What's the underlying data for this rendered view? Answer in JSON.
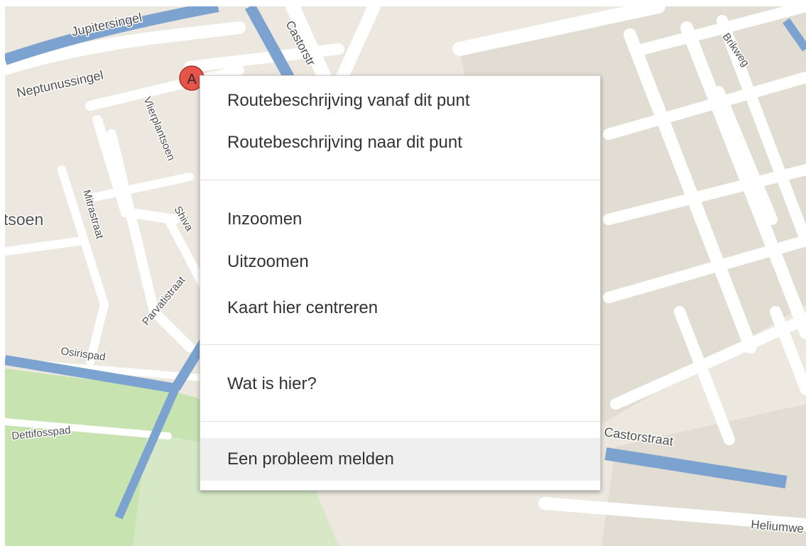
{
  "map": {
    "street_labels": {
      "jupitersingel": "Jupitersingel",
      "neptunussingel": "Neptunussingel",
      "castorstraat_top": "Castorstr",
      "brikweg": "Brikweg",
      "vlierplantsoen": "Vlierplantsoen",
      "plantsoen": "tsoen",
      "mitrastraat": "Mitrastraat",
      "shiva": "Shiva",
      "parvatistraat": "Parvatistraat",
      "osirispad": "Osirispad",
      "dettifosspad": "Dettifosspad",
      "castorstraat": "Castorstraat",
      "heliumweg": "Heliumwe"
    },
    "marker": {
      "label": "A",
      "color": "#e8544a"
    },
    "colors": {
      "land": "#ece8df",
      "block": "#e1ddd2",
      "road": "#ffffff",
      "water": "#7ca2cf",
      "park": "#c6e3b0"
    }
  },
  "context_menu": {
    "items": [
      {
        "label": "Routebeschrijving vanaf dit punt"
      },
      {
        "label": "Routebeschrijving naar dit punt"
      },
      {
        "label": "Inzoomen"
      },
      {
        "label": "Uitzoomen"
      },
      {
        "label": "Kaart hier centreren"
      },
      {
        "label": "Wat is hier?"
      },
      {
        "label": "Een probleem melden",
        "highlighted": true
      }
    ]
  }
}
